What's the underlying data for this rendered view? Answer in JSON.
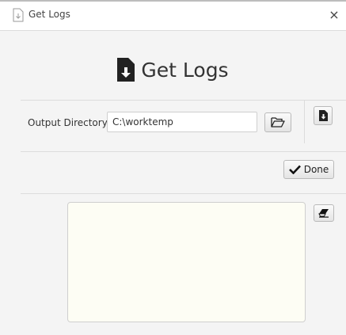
{
  "window": {
    "title": "Get Logs",
    "close_glyph": "×"
  },
  "heading": {
    "text": "Get Logs",
    "icon": "file-download-icon"
  },
  "output": {
    "label": "Output Directory:",
    "value": "C:\\worktemp",
    "browse_icon": "folder-open-icon",
    "export_icon": "file-download-icon"
  },
  "actions": {
    "done_label": "Done",
    "done_icon": "checkmark-icon",
    "clear_icon": "eraser-icon"
  },
  "log": {
    "content": ""
  },
  "colors": {
    "log_background": "#fdfdf4",
    "window_background": "#f4f4f4"
  }
}
